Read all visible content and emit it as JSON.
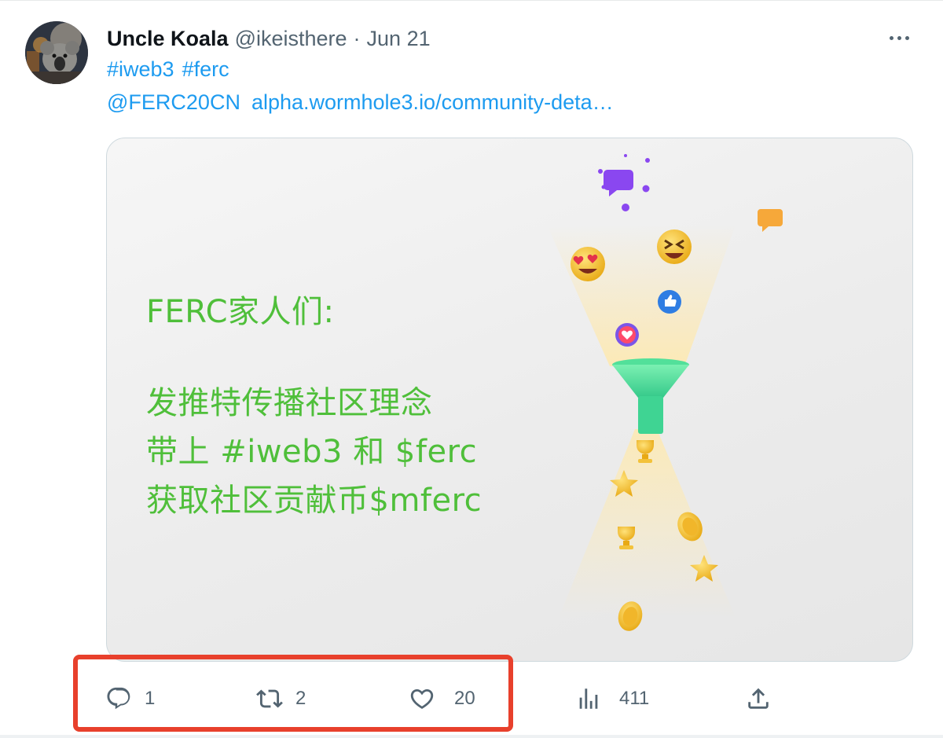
{
  "tweet": {
    "author_name": "Uncle Koala",
    "author_handle": "@ikeisthere",
    "separator": "·",
    "date": "Jun 21",
    "hashtags": [
      "#iweb3",
      "#ferc"
    ],
    "mention": "@FERC20CN",
    "url_text": "alpha.wormhole3.io/community-deta…"
  },
  "media": {
    "lines": [
      "FERC家人们:",
      "发推特传播社区理念",
      "带上 #iweb3 和 $ferc",
      "获取社区贡献币$mferc"
    ],
    "text_color": "#4fbf3a"
  },
  "actions": {
    "reply_count": "1",
    "retweet_count": "2",
    "like_count": "20",
    "views_count": "411"
  },
  "colors": {
    "accent": "#1d9bf0",
    "muted": "#536471",
    "highlight": "#e8402c"
  }
}
